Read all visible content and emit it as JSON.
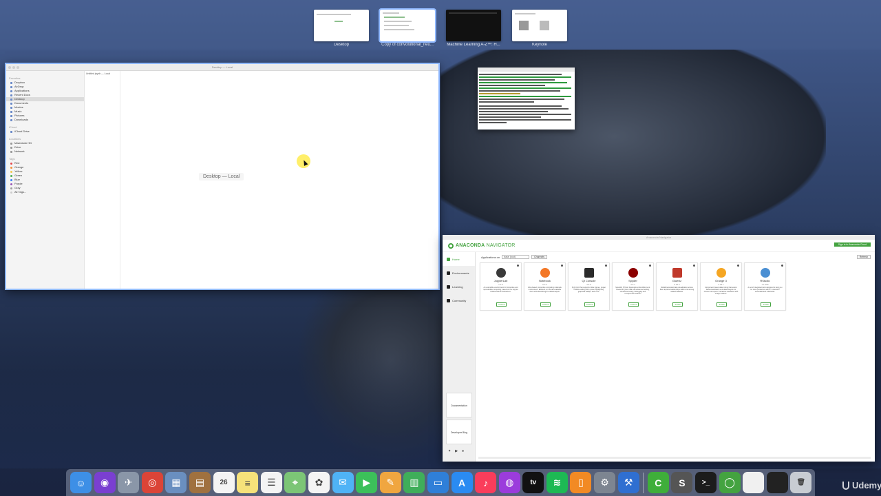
{
  "spaces": [
    {
      "label": "Desktop",
      "selected": false
    },
    {
      "label": "Copy of convolutional_neu...",
      "selected": true
    },
    {
      "label": "Machine Learning A-Z™: H...",
      "selected": false
    },
    {
      "label": "Keynote",
      "selected": false
    }
  ],
  "finder": {
    "title": "Desktop — Local",
    "empty_label": "Desktop — Local",
    "column_item": "Untitled.ipynb — Local",
    "sidebar": {
      "favorites_header": "Favorites",
      "favorites": [
        "Dropbox",
        "AirDrop",
        "Applications",
        "Recent Docs",
        "Desktop",
        "Documents",
        "Movies",
        "Music",
        "Pictures",
        "Downloads"
      ],
      "icloud_header": "iCloud",
      "icloud": [
        "iCloud Drive"
      ],
      "locations_header": "Locations",
      "locations": [
        "Macintosh HD",
        "Drive",
        "Network"
      ],
      "tags_header": "Tags",
      "tags": [
        "Red",
        "Orange",
        "Yellow",
        "Green",
        "Blue",
        "Purple",
        "Gray",
        "All Tags..."
      ]
    }
  },
  "anaconda": {
    "window_title": "Anaconda Navigator",
    "brand": "ANACONDA",
    "brand_suffix": " NAVIGATOR",
    "signin": "Sign in to Anaconda Cloud",
    "nav": [
      "Home",
      "Environments",
      "Learning",
      "Community"
    ],
    "side_cards": [
      "Documentation",
      "Developer Blog"
    ],
    "applications_on": "Applications on",
    "env_value": "base (root)",
    "channels": "Channels",
    "refresh": "Refresh",
    "apps": [
      {
        "name": "JupyterLab",
        "version": "1.2.6",
        "icon": "lab-icon",
        "color": "#3a3a3a",
        "desc": "An extensible environment for interactive and reproducible computing, based on the Jupyter Notebook and Architecture.",
        "action": "Launch"
      },
      {
        "name": "Notebook",
        "version": "6.0.3",
        "icon": "jupyter-icon",
        "color": "#f37726",
        "desc": "Web-based, interactive computing notebook environment. Edit and run human-readable docs while describing the data analysis.",
        "action": "Launch"
      },
      {
        "name": "Qt Console",
        "version": "4.6.0",
        "icon": "ipython-icon",
        "color": "#2b2b2b",
        "desc": "PyQt GUI that supports inline figures, proper multiline editing with syntax highlighting, graphical calltips, and more.",
        "action": "Launch"
      },
      {
        "name": "Spyder",
        "version": "4.0.1",
        "icon": "spyder-icon",
        "color": "#8c0000",
        "desc": "Scientific PYthon Development EnviRonment. Powerful Python IDE with advanced editing, interactive testing, debugging and introspection features",
        "action": "Launch"
      },
      {
        "name": "Glueviz",
        "version": "0.15.2",
        "icon": "glueviz-icon",
        "color": "#c0392b",
        "desc": "Multidimensional data visualization across files. Explore relationships within and among related datasets.",
        "action": "Install"
      },
      {
        "name": "Orange 3",
        "version": "3.23.1",
        "icon": "orange-icon",
        "color": "#f5a623",
        "desc": "Component based data mining framework. Data visualization and data analysis for novice and expert. Interactive workflows with a large toolbox.",
        "action": "Install"
      },
      {
        "name": "RStudio",
        "version": "1.1.456",
        "icon": "rstudio-icon",
        "color": "#4a8fd3",
        "desc": "A set of integrated tools designed to help you be more productive with R. Includes R essentials and notebooks.",
        "action": "Install"
      }
    ]
  },
  "dock": [
    {
      "name": "finder-icon",
      "color": "#3d8fe6",
      "glyph": "☺"
    },
    {
      "name": "siri-icon",
      "color": "#7a3fd1",
      "glyph": "◉"
    },
    {
      "name": "launchpad-icon",
      "color": "#8a96a8",
      "glyph": "✈"
    },
    {
      "name": "chrome-icon",
      "color": "#db4437",
      "glyph": "◎"
    },
    {
      "name": "preview-icon",
      "color": "#6a8fc0",
      "glyph": "▦"
    },
    {
      "name": "notebook-icon",
      "color": "#a0713f",
      "glyph": "▤"
    },
    {
      "name": "calendar-icon",
      "color": "#f4f4f4",
      "glyph": "26"
    },
    {
      "name": "notes-icon",
      "color": "#f6e27a",
      "glyph": "≡"
    },
    {
      "name": "reminders-icon",
      "color": "#f4f4f4",
      "glyph": "☰"
    },
    {
      "name": "maps-icon",
      "color": "#7cc576",
      "glyph": "⌖"
    },
    {
      "name": "photos-icon",
      "color": "#f4f4f4",
      "glyph": "✿"
    },
    {
      "name": "messages-icon",
      "color": "#4fb3f6",
      "glyph": "✉"
    },
    {
      "name": "facetime-icon",
      "color": "#3cc05a",
      "glyph": "▶"
    },
    {
      "name": "keynote-alt-icon",
      "color": "#f0a640",
      "glyph": "✎"
    },
    {
      "name": "numbers-icon",
      "color": "#3fae5a",
      "glyph": "▥"
    },
    {
      "name": "keynote-icon",
      "color": "#2f7fd8",
      "glyph": "▭"
    },
    {
      "name": "app-store-icon",
      "color": "#2a8bf2",
      "glyph": "A"
    },
    {
      "name": "music-icon",
      "color": "#fa3d5b",
      "glyph": "♪"
    },
    {
      "name": "podcasts-icon",
      "color": "#9b3cdc",
      "glyph": "◍"
    },
    {
      "name": "apple-tv-icon",
      "color": "#111111",
      "glyph": "tv"
    },
    {
      "name": "spotify-icon",
      "color": "#1db954",
      "glyph": "≋"
    },
    {
      "name": "books-icon",
      "color": "#f28a24",
      "glyph": "▯"
    },
    {
      "name": "system-preferences-icon",
      "color": "#7d8591",
      "glyph": "⚙"
    },
    {
      "name": "xcode-icon",
      "color": "#2f6fd1",
      "glyph": "⚒"
    },
    {
      "name": "camtasia-icon",
      "color": "#3fae3a",
      "glyph": "C"
    },
    {
      "name": "sublime-text-icon",
      "color": "#555555",
      "glyph": "S"
    },
    {
      "name": "terminal-icon",
      "color": "#1c1c1c",
      "glyph": ">_"
    },
    {
      "name": "anaconda-icon",
      "color": "#44a340",
      "glyph": "◯"
    },
    {
      "name": "document-icon",
      "color": "#f0f0f0",
      "glyph": ""
    },
    {
      "name": "screen-icon",
      "color": "#222222",
      "glyph": ""
    },
    {
      "name": "trash-icon",
      "color": "#c8ccd2",
      "glyph": "🗑"
    }
  ],
  "watermark": "Udemy"
}
